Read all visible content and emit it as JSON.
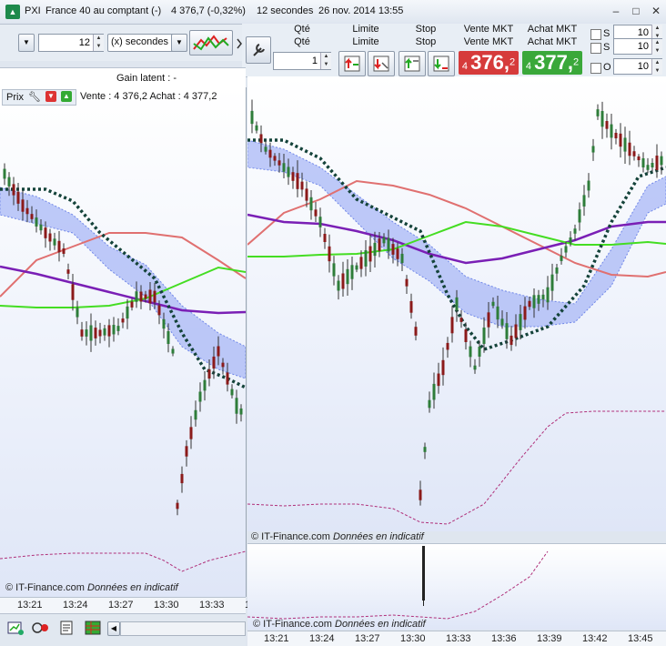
{
  "window": {
    "title_symbol": "PXI",
    "title_name": "France 40 au comptant (-)",
    "title_price": "4 376,7 (-0,32%)",
    "title_interval": "12 secondes",
    "title_datetime": "26 nov. 2014 13:55",
    "minimize": "–",
    "restore": "□",
    "close": "✕"
  },
  "toolbar": {
    "period_value": "12",
    "period_unit": "(x) secondes"
  },
  "left_chart": {
    "gain_latent": "Gain latent : -",
    "price_tab": "Prix",
    "quote_line": "Vente : 4 376,2 Achat : 4 377,2",
    "copyright_source": "© IT-Finance.com",
    "copyright_note": "Données en indicatif",
    "time_ticks": [
      "13:21",
      "13:24",
      "13:27",
      "13:30",
      "13:33",
      "1"
    ]
  },
  "order_bar": {
    "qty_header": "Qté",
    "qty_sub": "Qté",
    "qty_value": "1",
    "limit_header": "Limite",
    "limit_sub": "Limite",
    "stop_header": "Stop",
    "stop_sub": "Stop",
    "sell_header": "Vente MKT",
    "sell_sub": "Vente MKT",
    "sell_prefix": "4",
    "sell_big": "376,",
    "sell_suffix": "2",
    "buy_header": "Achat MKT",
    "buy_sub": "Achat MKT",
    "buy_prefix": "4",
    "buy_big": "377,",
    "buy_suffix": "2",
    "opt_s1": "S",
    "opt_s2": "S",
    "opt_o": "O",
    "opt_v1": "10",
    "opt_v2": "10",
    "opt_v3": "10",
    "sell_color": "#d63b3b",
    "buy_color": "#3aa83a"
  },
  "right_chart": {
    "copyright_source": "© IT-Finance.com",
    "copyright_note": "Données en indicatif",
    "time_ticks": [
      "13:21",
      "13:24",
      "13:27",
      "13:30",
      "13:33",
      "13:36",
      "13:39",
      "13:42",
      "13:45"
    ]
  },
  "colors": {
    "bull": "#2e7d3a",
    "bear": "#8b1a1a",
    "band_fill": "#a9b8f5",
    "dotted_envelope": "#14433a",
    "red_ma": "#e07070",
    "purple_ma": "#7a1fb5",
    "green_ma": "#44dd22",
    "volume_envelope": "#b0307a"
  }
}
